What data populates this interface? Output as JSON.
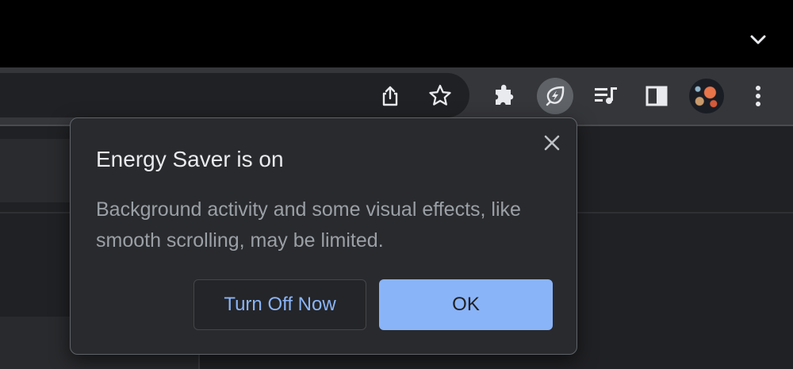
{
  "browser": {
    "tab_search_icon": "chevron-down-icon",
    "toolbar": {
      "share_icon": "share-icon",
      "bookmark_icon": "star-icon",
      "extensions_icon": "puzzle-piece-icon",
      "energy_saver_icon": "leaf-bolt-icon",
      "media_icon": "queue-music-icon",
      "side_panel_icon": "side-panel-icon",
      "menu_icon": "more-vertical-icon"
    }
  },
  "bubble": {
    "title": "Energy Saver is on",
    "body": "Background activity and some visual effects, like smooth scrolling, may be limited.",
    "close_icon": "close-icon",
    "turn_off_label": "Turn Off Now",
    "ok_label": "OK"
  },
  "colors": {
    "titlebar": "#000000",
    "toolbar": "#35363a",
    "bubble_bg": "#292a2d",
    "accent": "#8ab4f8"
  }
}
